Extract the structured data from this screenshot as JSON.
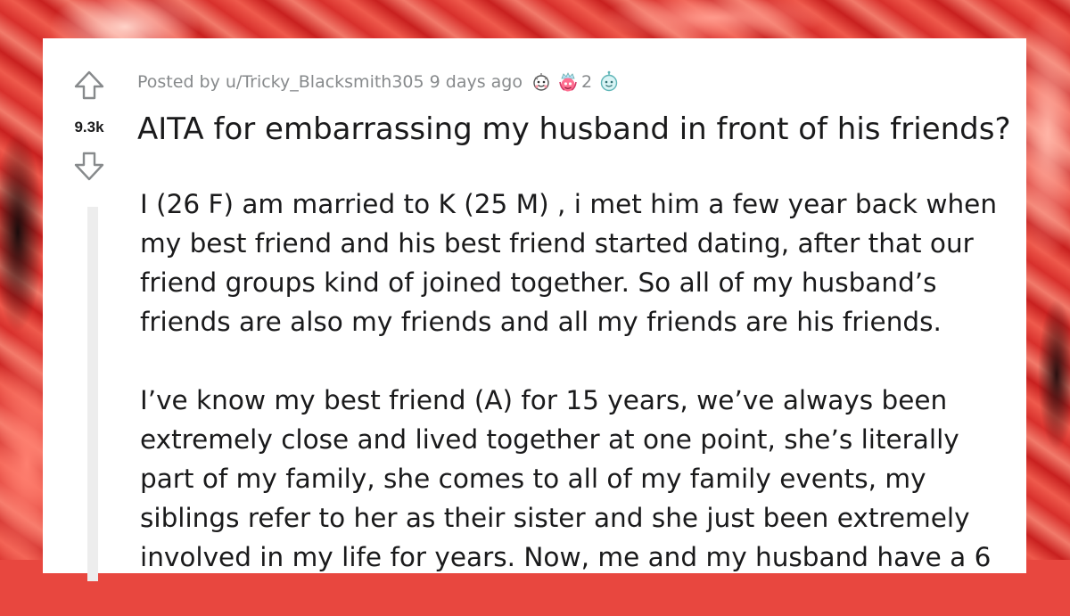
{
  "post": {
    "score": "9.3k",
    "posted_by": "Posted by u/Tricky_Blacksmith305 9 days ago",
    "awards": [
      {
        "icon": "wholesome-award-icon"
      },
      {
        "icon": "crowned-award-icon",
        "count": "2"
      },
      {
        "icon": "helpful-award-icon"
      }
    ],
    "title": "AITA for embarrassing my husband in front of his friends?",
    "paragraphs": [
      [
        "I (26 F) am married to K (25 M) , i met him a few year back when",
        "my best friend and his best friend started dating, after that our",
        "friend groups kind of joined together. So all of my husband’s",
        "friends are also my friends and all my friends are his friends."
      ],
      [
        "I’ve know my best friend (A) for 15 years, we’ve always been",
        "extremely close and lived together at one point, she’s literally",
        "part of my family, she comes to all of my family events, my",
        "siblings refer to her as their sister and she just been extremely",
        "involved in my life for years. Now, me and my husband have a 6"
      ]
    ]
  },
  "colors": {
    "card": "#ffffff",
    "text": "#1a1a1b",
    "meta": "#878a8c",
    "vote_arrow": "#878a8c",
    "background_accent": "#e8473f"
  }
}
